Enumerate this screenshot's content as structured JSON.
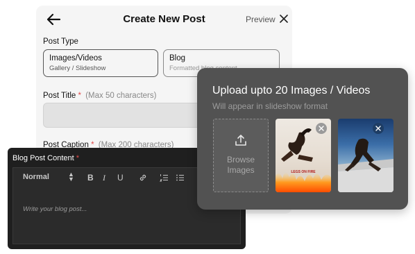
{
  "header": {
    "title": "Create New Post",
    "preview_label": "Preview",
    "back_icon": "arrow-left-icon",
    "close_icon": "close-icon"
  },
  "post_type": {
    "label": "Post Type",
    "options": [
      {
        "title": "Images/Videos",
        "subtitle": "Gallery / Slideshow",
        "selected": true
      },
      {
        "title": "Blog",
        "subtitle": "Formatted blog content",
        "selected": false
      }
    ]
  },
  "post_title": {
    "label": "Post Title",
    "required_mark": "*",
    "hint": "(Max 50 characters)",
    "value": ""
  },
  "post_caption": {
    "label": "Post Caption",
    "required_mark": "*",
    "hint": "(Max 200 characters)"
  },
  "blog_editor": {
    "label": "Blog Post Content",
    "required_mark": "*",
    "format_select": "Normal",
    "toolbar": [
      "bold-icon",
      "italic-icon",
      "underline-icon",
      "link-icon",
      "ordered-list-icon",
      "bullet-list-icon"
    ],
    "toolbar_glyphs": {
      "bold": "B",
      "italic": "I",
      "underline": "U"
    },
    "placeholder": "Write your blog post..."
  },
  "upload": {
    "title": "Upload upto 20 Images / Videos",
    "subtitle": "Will appear in slideshow format",
    "browse_line1": "Browse",
    "browse_line2": "Images",
    "upload_icon": "upload-icon",
    "thumbnails": [
      {
        "name": "image-thumbnail-1",
        "caption": "LEGS ON FIRE",
        "remove_icon": "close-icon"
      },
      {
        "name": "image-thumbnail-2",
        "remove_icon": "close-icon"
      }
    ]
  },
  "colors": {
    "panel_dark": "#525252",
    "editor_bg": "#1f1f1f",
    "required": "#e24a4a",
    "card_bg": "#f5f5f5"
  }
}
